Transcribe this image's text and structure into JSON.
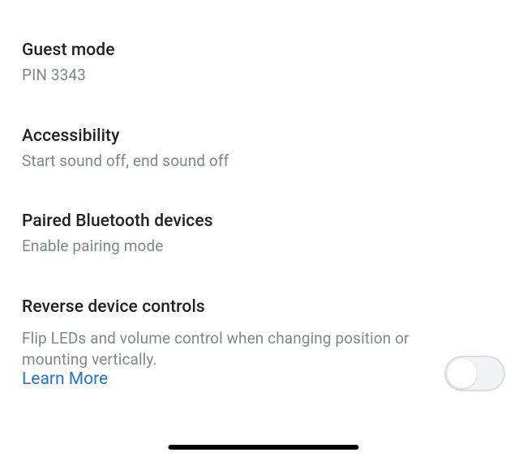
{
  "settings": {
    "guest_mode": {
      "title": "Guest mode",
      "subtitle": "PIN 3343"
    },
    "accessibility": {
      "title": "Accessibility",
      "subtitle": "Start sound off, end sound off"
    },
    "paired_bluetooth": {
      "title": "Paired Bluetooth devices",
      "subtitle": "Enable pairing mode"
    },
    "reverse_controls": {
      "title": "Reverse device controls",
      "subtitle": "Flip LEDs and volume control when changing position or mounting vertically.",
      "learn_more": "Learn More",
      "toggle_on": false
    }
  }
}
